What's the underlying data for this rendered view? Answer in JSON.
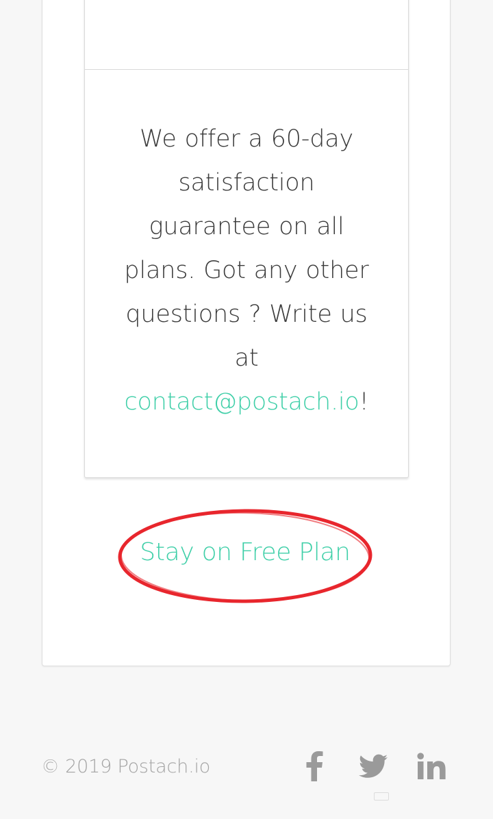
{
  "guarantee": {
    "text": "We offer a 60-day satisfaction guarantee on all plans. Got any other questions ? Write us at",
    "email": "contact@postach.io",
    "suffix": "!"
  },
  "free_plan": {
    "label": "Stay on Free Plan",
    "highlight_color": "#e8262d"
  },
  "footer": {
    "copyright": "© 2019 Postach.io",
    "social": [
      {
        "name": "facebook",
        "icon": "facebook-icon"
      },
      {
        "name": "twitter",
        "icon": "twitter-icon"
      },
      {
        "name": "linkedin",
        "icon": "linkedin-icon"
      }
    ]
  },
  "colors": {
    "accent": "#3fcfa8",
    "text": "#3b3b3b",
    "muted": "#a3a3a3",
    "background": "#f7f7f7"
  }
}
